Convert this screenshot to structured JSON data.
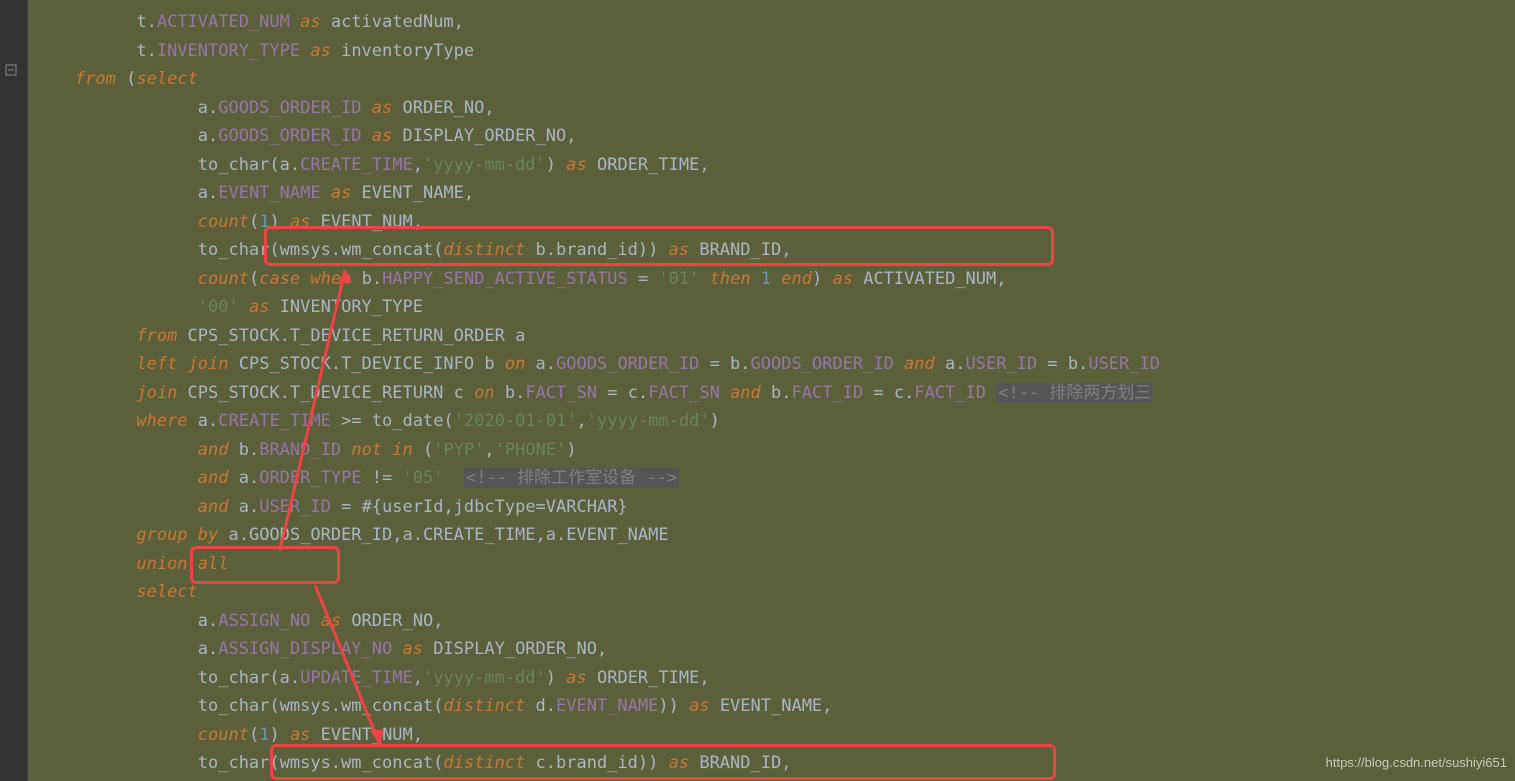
{
  "lines": {
    "l1_pre": "          t.",
    "l1_col": "ACTIVATED_NUM",
    "l1_as": " as ",
    "l1_alias": "activatedNum",
    "l1_comma": ",",
    "l2_pre": "          t.",
    "l2_col": "INVENTORY_TYPE",
    "l2_as": " as ",
    "l2_alias": "inventoryType",
    "l3_pre": "    ",
    "l3_from": "from ",
    "l3_paren": "(",
    "l3_select": "select",
    "l4_pre": "                a.",
    "l4_col": "GOODS_ORDER_ID",
    "l4_as": " as ",
    "l4_alias": "ORDER_NO",
    "l4_comma": ",",
    "l5_pre": "                a.",
    "l5_col": "GOODS_ORDER_ID",
    "l5_as": " as ",
    "l5_alias": "DISPLAY_ORDER_NO",
    "l5_comma": ",",
    "l6_pre": "                to_char(a.",
    "l6_col": "CREATE_TIME",
    "l6_mid": ",",
    "l6_str": "'yyyy-mm-dd'",
    "l6_close": ") ",
    "l6_as": "as ",
    "l6_alias": "ORDER_TIME",
    "l6_comma": ",",
    "l7_pre": "                a.",
    "l7_col": "EVENT_NAME",
    "l7_as": " as ",
    "l7_alias": "EVENT_NAME",
    "l7_comma": ",",
    "l8_pre": "                ",
    "l8_fn": "count",
    "l8_paren": "(",
    "l8_num": "1",
    "l8_close": ") ",
    "l8_as": "as ",
    "l8_alias": "EVENT_NUM",
    "l8_comma": ",",
    "l9_pre": "                to_char(wmsys.wm_concat(",
    "l9_dist": "distinct ",
    "l9_bid": "b.brand_id",
    "l9_close": ")) ",
    "l9_as": "as ",
    "l9_alias": "BRAND_ID",
    "l9_comma": ",",
    "l10_pre": "                ",
    "l10_fn": "count",
    "l10_paren": "(",
    "l10_case": "case ",
    "l10_when": "when ",
    "l10_bcol": "b.",
    "l10_col": "HAPPY_SEND_ACTIVE_STATUS",
    "l10_eq": " = ",
    "l10_str": "'01'",
    "l10_then": " then ",
    "l10_num": "1",
    "l10_end": " end",
    "l10_close": ") ",
    "l10_as": "as ",
    "l10_alias": "ACTIVATED_NUM",
    "l10_comma": ",",
    "l11_pre": "                ",
    "l11_str": "'00'",
    "l11_as": " as ",
    "l11_alias": "INVENTORY_TYPE",
    "l12_pre": "          ",
    "l12_from": "from ",
    "l12_tbl": "CPS_STOCK.T_DEVICE_RETURN_ORDER a",
    "l13_pre": "          ",
    "l13_lj": "left join ",
    "l13_tbl": "CPS_STOCK.T_DEVICE_INFO b ",
    "l13_on": "on ",
    "l13_a": "a.",
    "l13_col1": "GOODS_ORDER_ID",
    "l13_eq1": " = b.",
    "l13_col2": "GOODS_ORDER_ID",
    "l13_and1": " and ",
    "l13_a2": "a.",
    "l13_col3": "USER_ID",
    "l13_eq2": " = b.",
    "l13_col4": "USER_ID",
    "l14_pre": "          ",
    "l14_join": "join ",
    "l14_tbl": "CPS_STOCK.T_DEVICE_RETURN c ",
    "l14_on": "on ",
    "l14_b": "b.",
    "l14_col1": "FACT_SN",
    "l14_eq1": " = c.",
    "l14_col2": "FACT_SN",
    "l14_and": " and ",
    "l14_b2": "b.",
    "l14_col3": "FACT_ID",
    "l14_eq2": " = c.",
    "l14_col4": "FACT_ID",
    "l14_sp": " ",
    "l14_cmt": "<!-- 排除两方划三",
    "l15_pre": "          ",
    "l15_where": "where ",
    "l15_a": "a.",
    "l15_col": "CREATE_TIME",
    "l15_gte": " >= ",
    "l15_fn": "to_date(",
    "l15_str1": "'2020-01-01'",
    "l15_comma": ",",
    "l15_str2": "'yyyy-mm-dd'",
    "l15_close": ")",
    "l16_pre": "                ",
    "l16_and": "and ",
    "l16_b": "b.",
    "l16_col": "BRAND_ID",
    "l16_notin": " not in ",
    "l16_paren": "(",
    "l16_str1": "'PYP'",
    "l16_comma": ",",
    "l16_str2": "'PHONE'",
    "l16_close": ")",
    "l17_pre": "                ",
    "l17_and": "and ",
    "l17_a": "a.",
    "l17_col": "ORDER_TYPE",
    "l17_neq": " != ",
    "l17_str": "'05'",
    "l17_sp": "  ",
    "l17_cmt": "<!-- 排除工作室设备 -->",
    "l18_pre": "                ",
    "l18_and": "and ",
    "l18_a": "a.",
    "l18_col": "USER_ID",
    "l18_eq": " = #{userId,jdbcType=VARCHAR}",
    "l19_pre": "          ",
    "l19_gb": "group by ",
    "l19_cols": "a.GOODS_ORDER_ID,a.CREATE_TIME,a.EVENT_NAME",
    "l20_pre": "          ",
    "l20_union": "union all",
    "l21_pre": "          ",
    "l21_select": "select",
    "l22_pre": "                a.",
    "l22_col": "ASSIGN_NO",
    "l22_as": " as ",
    "l22_alias": "ORDER_NO",
    "l22_comma": ",",
    "l23_pre": "                a.",
    "l23_col": "ASSIGN_DISPLAY_NO",
    "l23_as": " as ",
    "l23_alias": "DISPLAY_ORDER_NO",
    "l23_comma": ",",
    "l24_pre": "                to_char(a.",
    "l24_col": "UPDATE_TIME",
    "l24_mid": ",",
    "l24_str": "'yyyy-mm-dd'",
    "l24_close": ") ",
    "l24_as": "as ",
    "l24_alias": "ORDER_TIME",
    "l24_comma": ",",
    "l25_pre": "                to_char(wmsys.wm_concat(",
    "l25_dist": "distinct ",
    "l25_d": "d.",
    "l25_col": "EVENT_NAME",
    "l25_close": ")) ",
    "l25_as": "as ",
    "l25_alias": "EVENT_NAME",
    "l25_comma": ",",
    "l26_pre": "                ",
    "l26_fn": "count",
    "l26_paren": "(",
    "l26_num": "1",
    "l26_close": ") ",
    "l26_as": "as ",
    "l26_alias": "EVENT_NUM",
    "l26_comma": ",",
    "l27_pre": "                to_char(wmsys.wm_concat(",
    "l27_dist": "distinct ",
    "l27_c": "c.brand_id",
    "l27_close": ")) ",
    "l27_as": "as ",
    "l27_alias": "BRAND_ID",
    "l27_comma": ","
  },
  "watermark": "https://blog.csdn.net/sushiyi651"
}
